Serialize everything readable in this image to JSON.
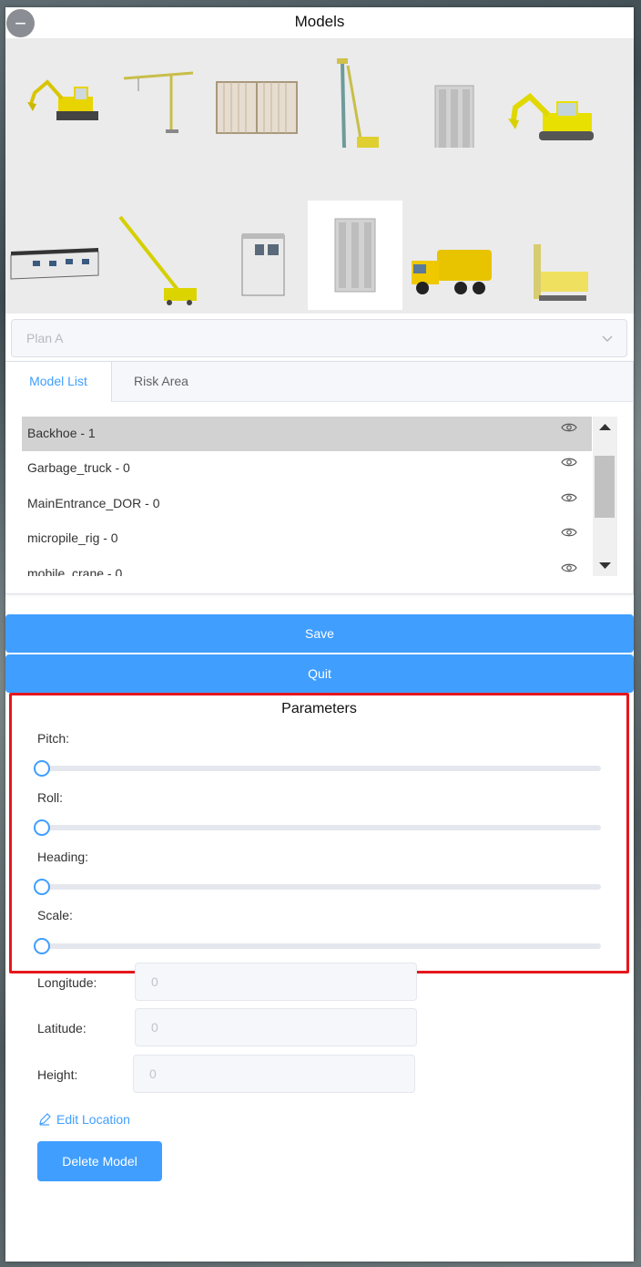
{
  "window": {
    "title": "Models"
  },
  "gallery": {
    "models": [
      {
        "icon": "backhoe-icon"
      },
      {
        "icon": "tower-crane-icon"
      },
      {
        "icon": "fence-panels-icon"
      },
      {
        "icon": "micropile-rig-icon"
      },
      {
        "icon": "door-panel-icon"
      },
      {
        "icon": "excavator-icon"
      },
      {
        "icon": "site-office-icon"
      },
      {
        "icon": "mobile-crane-icon"
      },
      {
        "icon": "guard-booth-icon"
      },
      {
        "icon": "door-panel-icon",
        "selected": true
      },
      {
        "icon": "garbage-truck-icon"
      },
      {
        "icon": "drill-rig-icon"
      }
    ]
  },
  "plan_select": {
    "value": "Plan A"
  },
  "tabs": [
    {
      "label": "Model List",
      "active": true
    },
    {
      "label": "Risk Area",
      "active": false
    }
  ],
  "model_list": [
    {
      "name": "Backhoe - 1",
      "selected": true
    },
    {
      "name": "Garbage_truck - 0"
    },
    {
      "name": "MainEntrance_DOR - 0"
    },
    {
      "name": "micropile_rig - 0"
    },
    {
      "name": "mobile  crane - 0"
    }
  ],
  "actions": {
    "save": "Save",
    "quit": "Quit"
  },
  "parameters": {
    "title": "Parameters",
    "sliders": [
      {
        "label": "Pitch:",
        "value": 0
      },
      {
        "label": "Roll:",
        "value": 0
      },
      {
        "label": "Heading:",
        "value": 0
      },
      {
        "label": "Scale:",
        "value": 0
      }
    ]
  },
  "location": {
    "longitude_label": "Longitude:",
    "longitude_value": "0",
    "latitude_label": "Latitude:",
    "latitude_value": "0",
    "height_label": "Height:",
    "height_value": "0"
  },
  "edit_location": "Edit Location",
  "delete_model": "Delete Model",
  "colors": {
    "accent": "#409eff",
    "highlight_border": "#e5171d"
  }
}
